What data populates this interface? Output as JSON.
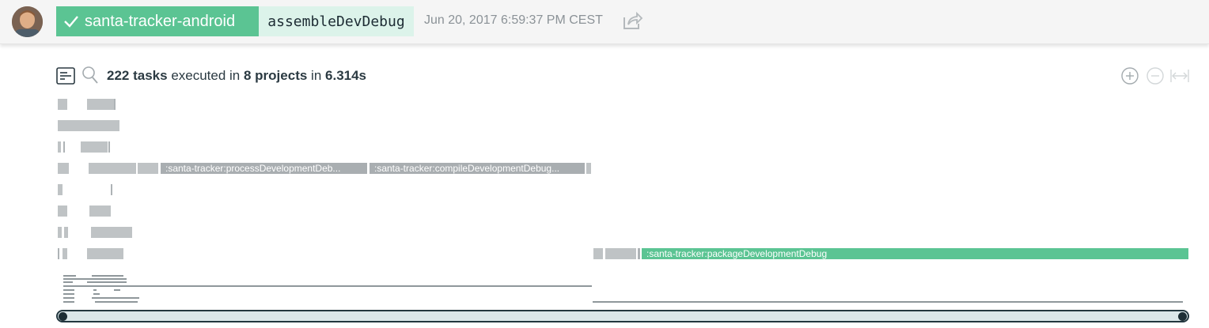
{
  "header": {
    "avatar_alt": "user avatar",
    "project_name": "santa-tracker-android",
    "task_name": "assembleDevDebug",
    "build_time": "Jun 20, 2017 6:59:37 PM CEST",
    "share_icon": "share-icon",
    "status_icon": "check-icon",
    "colors": {
      "success": "#5bc493",
      "task_bg": "#dcf3ea",
      "header_bg": "#f5f5f5"
    }
  },
  "summary": {
    "tasks_count": "222 tasks",
    "executed_in": "executed in",
    "projects_count": "8 projects",
    "in_word": "in",
    "duration": "6.314s",
    "icons": [
      "list-icon",
      "search-icon",
      "zoom-in-icon",
      "zoom-out-icon",
      "fit-width-icon"
    ]
  },
  "timeline": {
    "labels": {
      "process": ":santa-tracker:processDevelopmentDeb...",
      "compile": ":santa-tracker:compileDevelopmentDebug...",
      "package": ":santa-tracker:packageDevelopmentDebug"
    },
    "colors": {
      "task": "#bfc3c5",
      "highlight": "#5bc493"
    }
  },
  "scrollbar": {
    "handle_color": "#1d2e35",
    "track_color": "#dbe7e9"
  }
}
